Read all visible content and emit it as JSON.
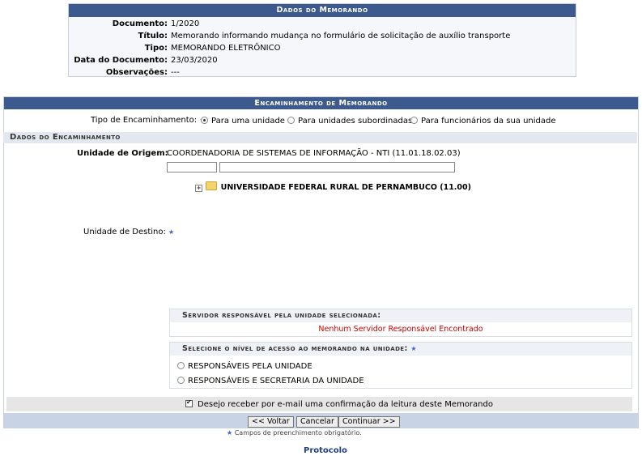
{
  "memo": {
    "title": "Dados do Memorando",
    "fields": [
      {
        "label": "Documento:",
        "value": "1/2020"
      },
      {
        "label": "Título:",
        "value": "Memorando informando mudança no formulário de solicitação de auxílio transporte"
      },
      {
        "label": "Tipo:",
        "value": "MEMORANDO ELETRÔNICO"
      },
      {
        "label": "Data do Documento:",
        "value": "23/03/2020"
      },
      {
        "label": "Observações:",
        "value": "---"
      }
    ]
  },
  "encaminhamento": {
    "title": "Encaminhamento de Memorando",
    "tipo_label": "Tipo de Encaminhamento:",
    "options": [
      "Para uma unidade",
      "Para unidades subordinadas",
      "Para funcionários da sua unidade"
    ],
    "selected": "Para uma unidade",
    "section_title": "Dados do Encaminhamento",
    "origem_label": "Unidade de Origem:",
    "origem_value": "COORDENADORIA DE SISTEMAS DE INFORMAÇÃO - NTI (11.01.18.02.03)",
    "tree_root": "UNIVERSIDADE FEDERAL RURAL DE PERNAMBUCO (11.00)",
    "destino_label": "Unidade de Destino:",
    "servidor_title": "Servidor responsável pela unidade selecionada:",
    "servidor_empty": "Nenhum Servidor Responsável Encontrado",
    "nivel_title": "Selecione o nível de acesso ao memorando na unidade:",
    "nivel_options": [
      "RESPONSÁVEIS PELA UNIDADE",
      "RESPONSÁVEIS E SECRETARIA DA UNIDADE"
    ],
    "email_label": "Desejo receber por e-mail uma confirmação da leitura deste Memorando",
    "email_checked": true
  },
  "buttons": {
    "back": "<< Voltar",
    "cancel": "Cancelar",
    "continue": "Continuar >>"
  },
  "required_note": "Campos de preenchimento obrigatório.",
  "footer_link": "Protocolo",
  "colors": {
    "header": "#3d5a8f",
    "required_star": "#3c5fd1",
    "error_text": "#cc0000",
    "link": "#1f3f86"
  }
}
